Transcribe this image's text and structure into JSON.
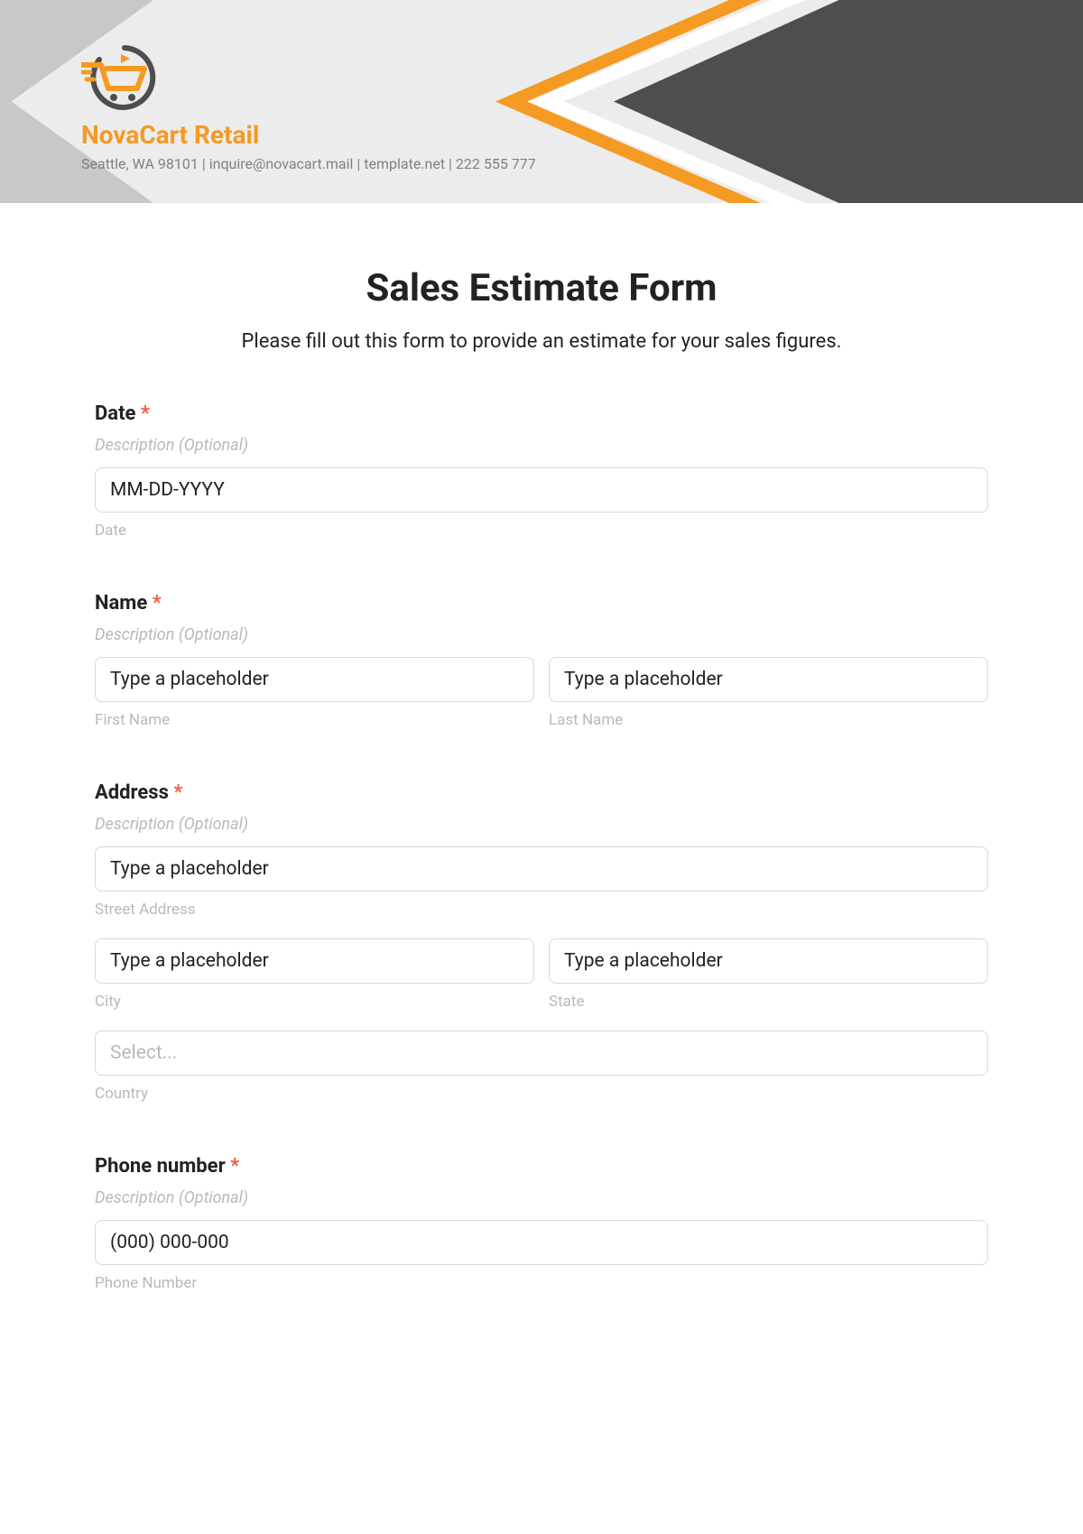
{
  "brand": {
    "name": "NovaCart Retail",
    "sub": "Seattle, WA 98101 | inquire@novacart.mail | template.net | 222 555 777"
  },
  "page": {
    "title": "Sales Estimate Form",
    "description": "Please fill out this form to provide an estimate for your sales figures."
  },
  "fields": {
    "date": {
      "label": "Date",
      "asterisk": "*",
      "desc": "Description (Optional)",
      "placeholder": "MM-DD-YYYY",
      "sub": "Date"
    },
    "name": {
      "label": "Name",
      "asterisk": "*",
      "desc": "Description (Optional)",
      "first_placeholder": "Type a placeholder",
      "first_sub": "First Name",
      "last_placeholder": "Type a placeholder",
      "last_sub": "Last Name"
    },
    "address": {
      "label": "Address",
      "asterisk": "*",
      "desc": "Description (Optional)",
      "street_placeholder": "Type a placeholder",
      "street_sub": "Street Address",
      "city_placeholder": "Type a placeholder",
      "city_sub": "City",
      "state_placeholder": "Type a placeholder",
      "state_sub": "State",
      "country_placeholder": "Select...",
      "country_sub": "Country"
    },
    "phone": {
      "label": "Phone number",
      "asterisk": "*",
      "desc": "Description (Optional)",
      "placeholder": "(000) 000-000",
      "sub": "Phone Number"
    }
  }
}
